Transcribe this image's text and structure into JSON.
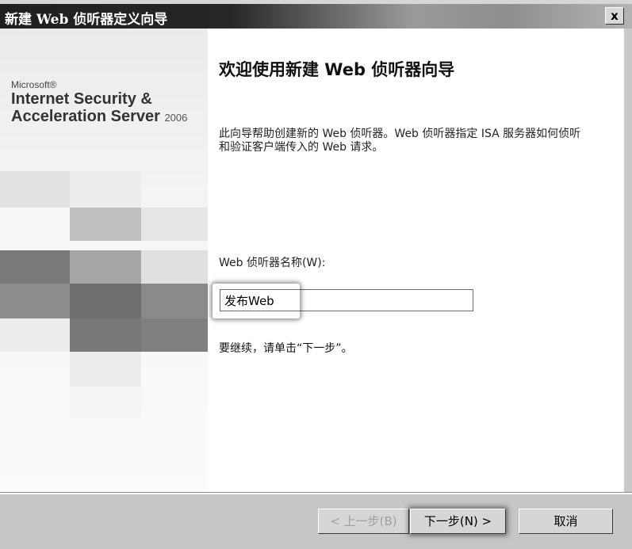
{
  "window": {
    "title": "新建 Web 侦听器定义向导",
    "close_label": "x"
  },
  "sidebar": {
    "brand_company": "Microsoft®",
    "brand_product_line1": "Internet Security &",
    "brand_product_line2": "Acceleration Server",
    "brand_year": "2006"
  },
  "main": {
    "heading": "欢迎使用新建 Web 侦听器向导",
    "description": "此向导帮助创建新的 Web 侦听器。Web 侦听器指定 ISA 服务器如何侦听和验证客户端传入的 Web 请求。",
    "field_label": "Web 侦听器名称(W):",
    "name_value": "发布Web",
    "continue_text": "要继续，请单击“下一步”。"
  },
  "footer": {
    "back_label": "< 上一步(B)",
    "next_label": "下一步(N) >",
    "cancel_label": "取消"
  },
  "colors": {
    "titlebar_dark": "#202020",
    "footer_bg": "#c6c6c6",
    "sidebar_bg": "#f2f2f2"
  }
}
